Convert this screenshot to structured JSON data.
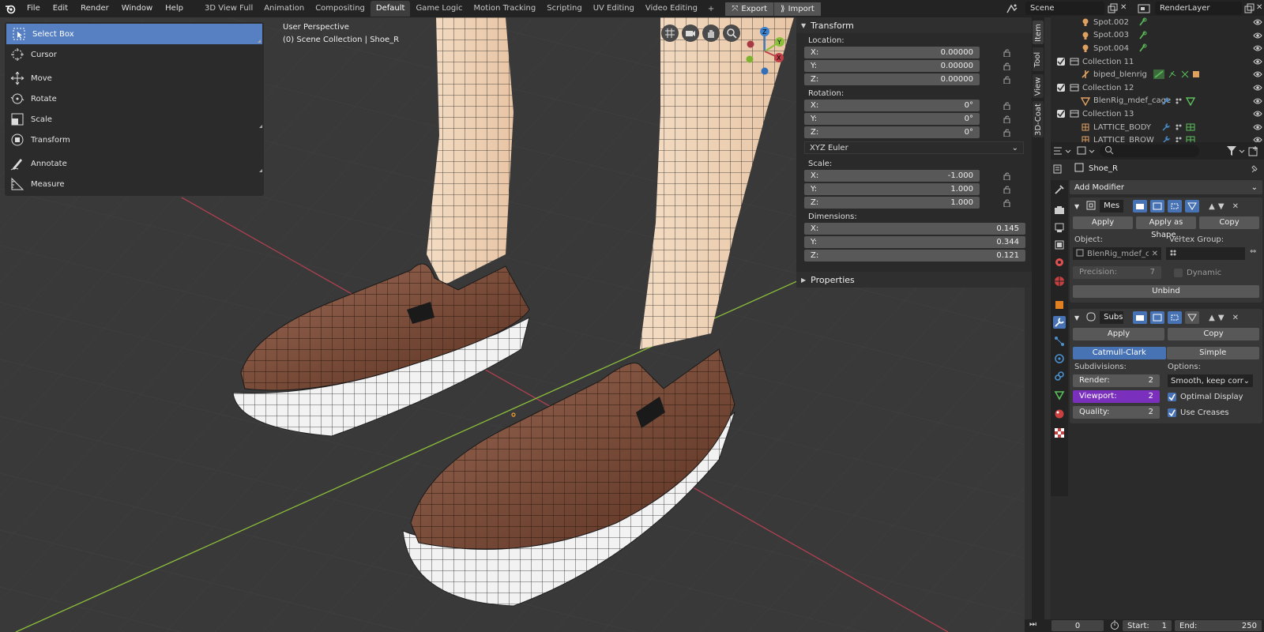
{
  "topbar": {
    "menus": [
      "File",
      "Edit",
      "Render",
      "Window",
      "Help"
    ],
    "workspaces": [
      "3D View Full",
      "Animation",
      "Compositing",
      "Default",
      "Game Logic",
      "Motion Tracking",
      "Scripting",
      "UV Editing",
      "Video Editing"
    ],
    "active_workspace": "Default",
    "add_tab": "+",
    "export_label": "Export",
    "import_label": "Import",
    "scene": "Scene",
    "render_layer": "RenderLayer"
  },
  "viewport": {
    "perspective": "User Perspective",
    "collection": "(0) Scene Collection | Shoe_R"
  },
  "toolbar": {
    "items": [
      "Select Box",
      "Cursor",
      "Move",
      "Rotate",
      "Scale",
      "Transform",
      "Annotate",
      "Measure"
    ],
    "active": "Select Box"
  },
  "gizmo": {
    "x": "X",
    "y": "Y",
    "z": "Z"
  },
  "transform_panel": {
    "title": "Transform",
    "location_label": "Location:",
    "location": {
      "x": "0.00000",
      "y": "0.00000",
      "z": "0.00000"
    },
    "rotation_label": "Rotation:",
    "rotation": {
      "x": "0°",
      "y": "0°",
      "z": "0°"
    },
    "rotation_mode": "XYZ Euler",
    "scale_label": "Scale:",
    "scale": {
      "x": "-1.000",
      "y": "1.000",
      "z": "1.000"
    },
    "dimensions_label": "Dimensions:",
    "dimensions": {
      "x": "0.145",
      "y": "0.344",
      "z": "0.121"
    },
    "axis_x": "X:",
    "axis_y": "Y:",
    "axis_z": "Z:"
  },
  "properties_panel": {
    "title": "Properties"
  },
  "side_tabs": [
    "Item",
    "Tool",
    "View",
    "3D-Coat"
  ],
  "outliner": {
    "rows": [
      {
        "name": "Spot.002",
        "indent": 2,
        "type": "light"
      },
      {
        "name": "Spot.003",
        "indent": 2,
        "type": "light"
      },
      {
        "name": "Spot.004",
        "indent": 2,
        "type": "light"
      },
      {
        "name": "Collection 11",
        "indent": 1,
        "type": "collection"
      },
      {
        "name": "biped_blenrig",
        "indent": 2,
        "type": "armature"
      },
      {
        "name": "Collection 12",
        "indent": 1,
        "type": "collection"
      },
      {
        "name": "BlenRig_mdef_cage",
        "indent": 2,
        "type": "mesh"
      },
      {
        "name": "Collection 13",
        "indent": 1,
        "type": "collection"
      },
      {
        "name": "LATTICE_BODY",
        "indent": 2,
        "type": "lattice"
      },
      {
        "name": "LATTICE_BROW",
        "indent": 2,
        "type": "lattice"
      }
    ]
  },
  "props_editor": {
    "object_name": "Shoe_R",
    "add_modifier": "Add Modifier",
    "mod1": {
      "name": "Mes",
      "apply": "Apply",
      "apply_shape": "Apply as Shape..",
      "copy": "Copy",
      "object_label": "Object:",
      "object_value": "BlenRig_mdef_c...",
      "vgroup_label": "Vertex Group:",
      "precision_label": "Precision:",
      "precision_value": "7",
      "dynamic_label": "Dynamic",
      "unbind": "Unbind"
    },
    "mod2": {
      "name": "Subs",
      "apply": "Apply",
      "copy": "Copy",
      "catmull": "Catmull-Clark",
      "simple": "Simple",
      "subdiv_label": "Subdivisions:",
      "options_label": "Options:",
      "render_label": "Render:",
      "render_value": "2",
      "viewport_label": "Viewport:",
      "viewport_value": "2",
      "quality_label": "Quality:",
      "quality_value": "2",
      "uv_smooth": "Smooth, keep corners",
      "optimal_display": "Optimal Display",
      "use_creases": "Use Creases"
    }
  },
  "timeline": {
    "frame": "0",
    "start_label": "Start:",
    "start_value": "1",
    "end_label": "End:",
    "end_value": "250"
  },
  "colors": {
    "accent": "#5680c2",
    "x_axis": "#c0404a",
    "y_axis": "#8cbf3a",
    "z_axis": "#3c80cc",
    "viewport_purple": "#7a2fbd"
  }
}
